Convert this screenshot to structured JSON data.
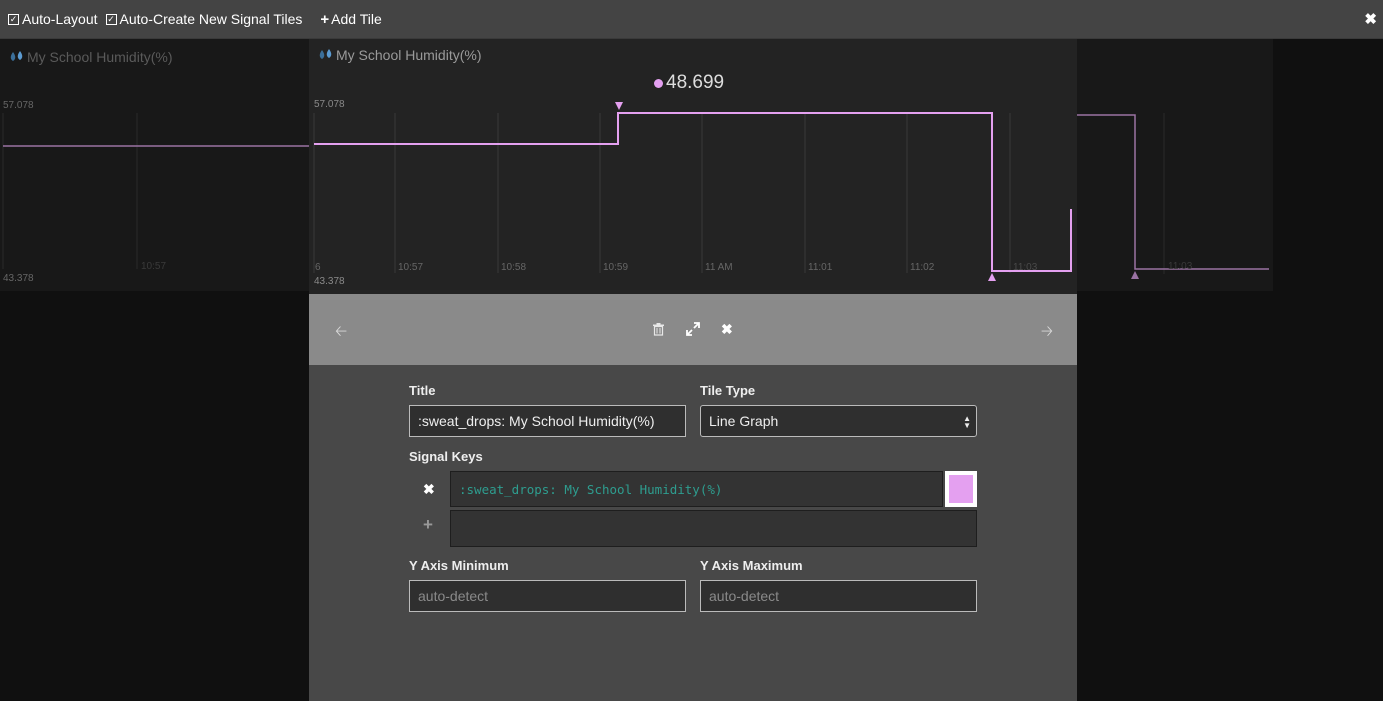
{
  "toolbar": {
    "auto_layout": "Auto-Layout",
    "auto_create": "Auto-Create New Signal Tiles",
    "add_tile": "Add Tile"
  },
  "tiles": {
    "left": {
      "title": "My School Humidity(%)",
      "max": "57.078",
      "min": "43.378",
      "time": "10:57"
    },
    "main": {
      "title": "My School Humidity(%)",
      "current_value": "48.699",
      "max": "57.078",
      "min": "43.378",
      "x_ticks": [
        "6",
        "10:57",
        "10:58",
        "10:59",
        "11 AM",
        "11:01",
        "11:02",
        "11:03"
      ]
    },
    "right": {
      "time": "11:03"
    }
  },
  "colors": {
    "series": "#e4a0f0",
    "accent": "#2e9d8f"
  },
  "editor": {
    "title_label": "Title",
    "title_value": ":sweat_drops: My School Humidity(%)",
    "tile_type_label": "Tile Type",
    "tile_type_value": "Line Graph",
    "signal_keys_label": "Signal Keys",
    "signal_key_1": ":sweat_drops: My School Humidity(%)",
    "y_min_label": "Y Axis Minimum",
    "y_min_placeholder": "auto-detect",
    "y_max_label": "Y Axis Maximum",
    "y_max_placeholder": "auto-detect"
  },
  "icons": {
    "prev": "arrow-left-icon",
    "next": "arrow-right-icon",
    "delete": "trash-icon",
    "expand": "expand-icon",
    "close": "close-icon"
  }
}
